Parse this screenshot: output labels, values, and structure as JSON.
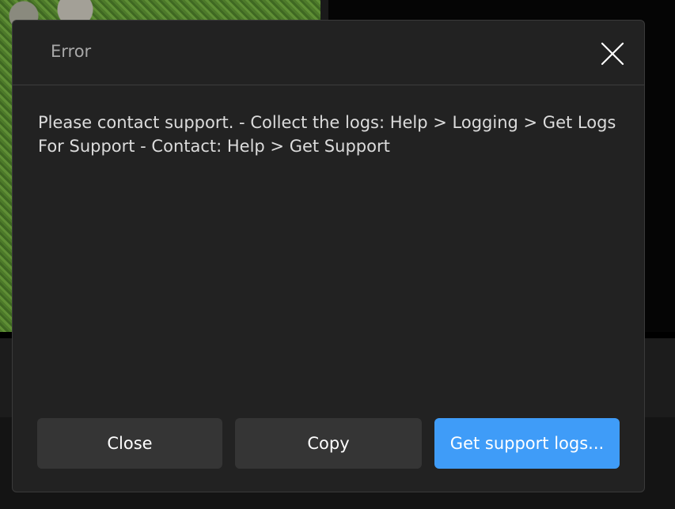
{
  "dialog": {
    "title": "Error",
    "message": "Please contact support. - Collect the logs: Help > Logging > Get Logs For Support - Contact: Help > Get Support",
    "close_icon": "close-icon",
    "buttons": {
      "close_label": "Close",
      "copy_label": "Copy",
      "support_label": "Get support logs..."
    }
  },
  "colors": {
    "dialog_bg": "#222222",
    "secondary_button": "#353535",
    "primary_button": "#3f9cf8",
    "title_text": "#a8a8a8",
    "body_text": "#dcdcdc"
  }
}
